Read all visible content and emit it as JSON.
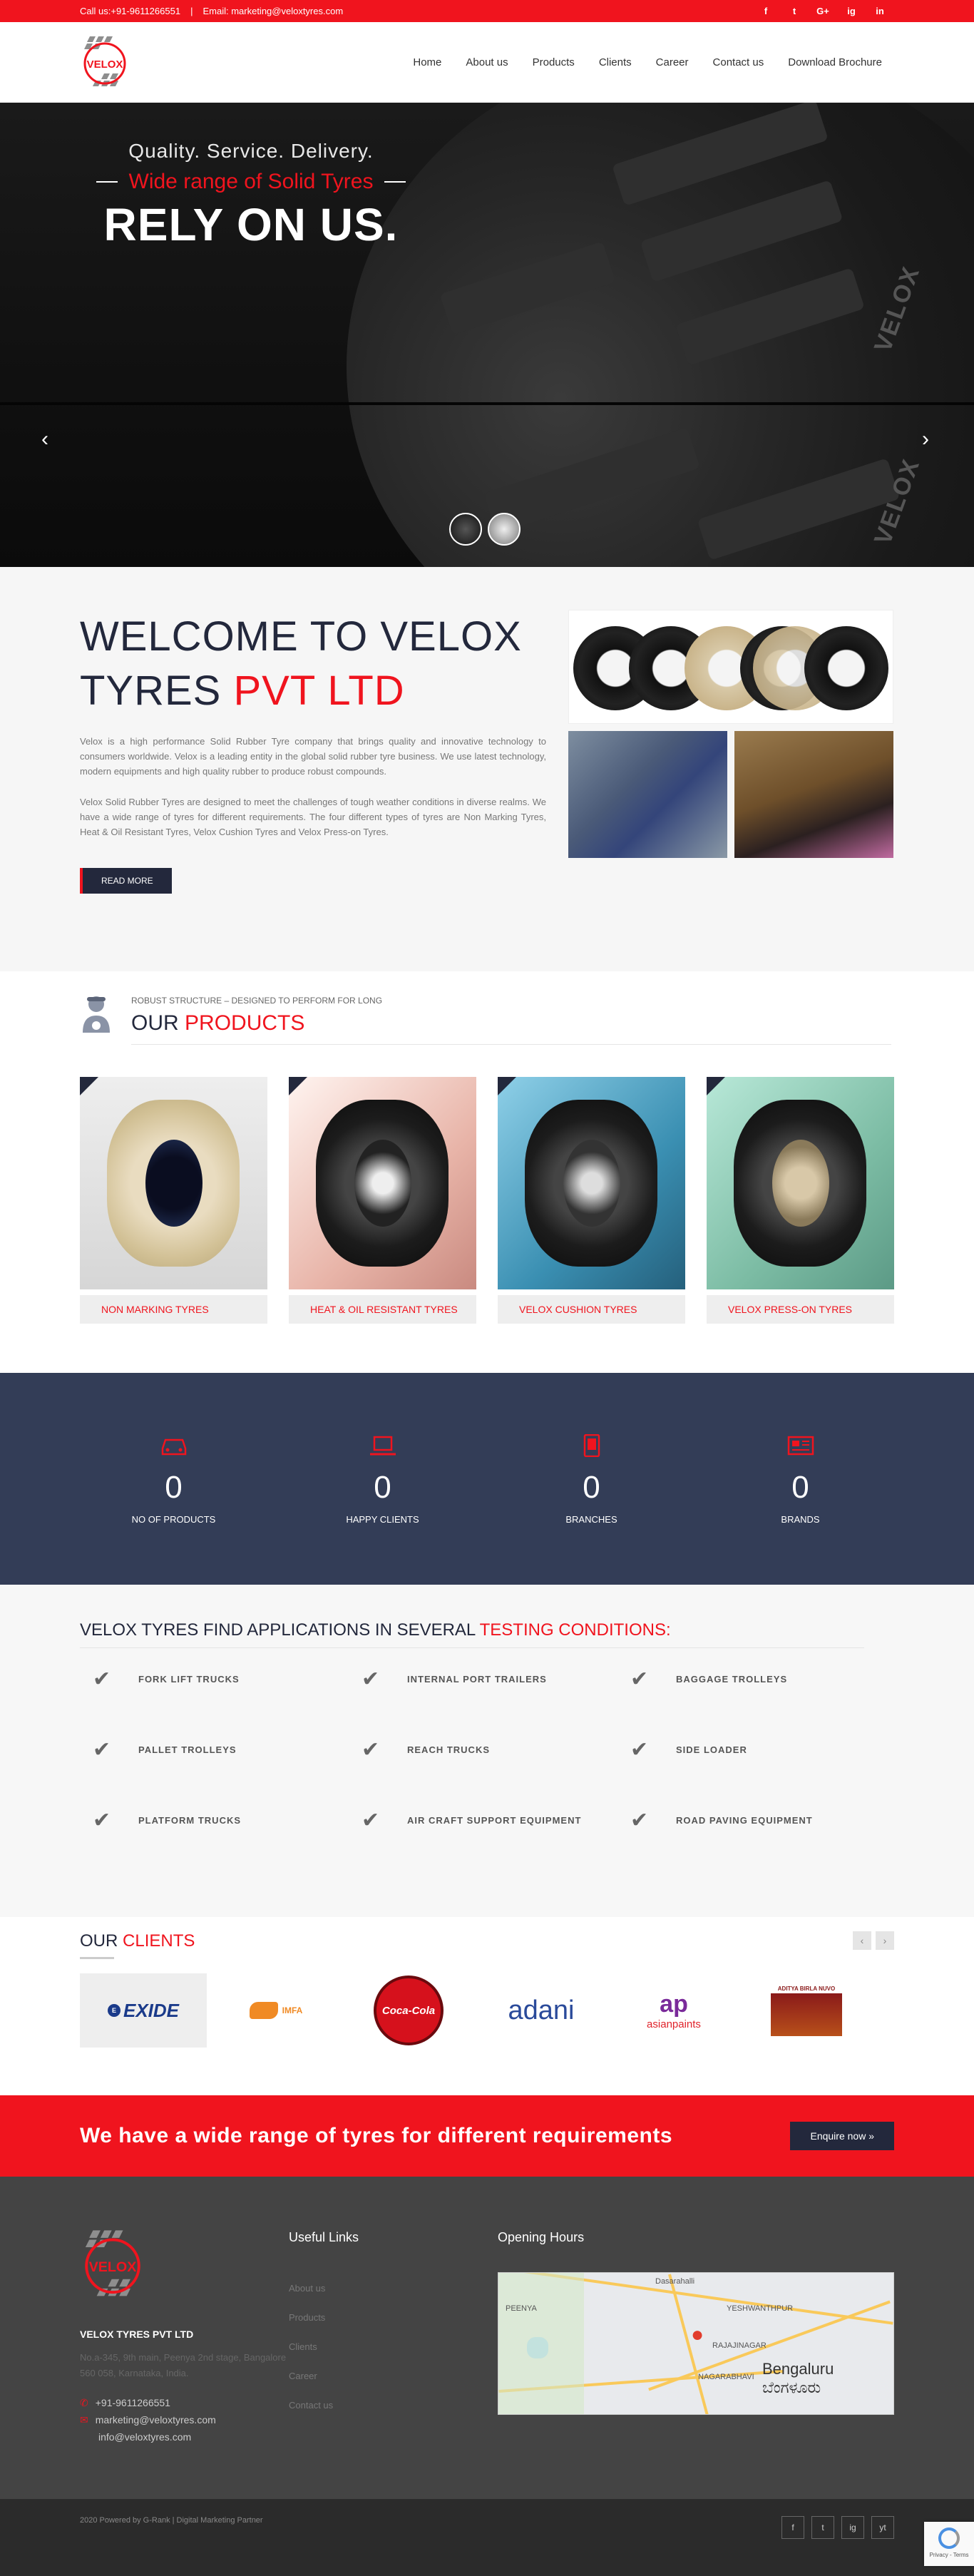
{
  "topbar": {
    "call": "Call us:+91-9611266551",
    "email": "Email: marketing@veloxtyres.com",
    "social": [
      "f",
      "t",
      "G+",
      "ig",
      "in"
    ]
  },
  "header": {
    "logo_text": "VELOX",
    "nav": [
      "Home",
      "About us",
      "Products",
      "Clients",
      "Career",
      "Contact us",
      "Download Brochure"
    ]
  },
  "hero": {
    "line1": "Quality. Service. Delivery.",
    "line2": "Wide range of Solid Tyres",
    "line3": "RELY ON US.",
    "brand": "VELOX"
  },
  "welcome": {
    "title_a": "WELCOME TO VELOX",
    "title_b": "TYRES",
    "title_c": "PVT LTD",
    "para1": "Velox is a high performance Solid Rubber Tyre company that brings quality and innovative technology to consumers worldwide. Velox is a leading entity in the global solid rubber tyre business. We use latest technology, modern equipments and high quality rubber to produce robust compounds.",
    "para2": "Velox Solid Rubber Tyres are designed to meet the challenges of tough weather conditions in diverse realms. We have a wide range of tyres for different requirements. The four different types of tyres are Non Marking Tyres, Heat & Oil Resistant Tyres, Velox Cushion Tyres and Velox Press-on Tyres.",
    "button": "READ MORE"
  },
  "products": {
    "tagline": "ROBUST STRUCTURE – DESIGNED TO PERFORM FOR LONG",
    "title_a": "OUR",
    "title_b": "PRODUCTS",
    "items": [
      {
        "label": "NON MARKING TYRES"
      },
      {
        "label": "HEAT & OIL RESISTANT TYRES"
      },
      {
        "label": "VELOX CUSHION TYRES"
      },
      {
        "label": "VELOX PRESS-ON TYRES"
      }
    ]
  },
  "counters": [
    {
      "num": "0",
      "label": "NO OF PRODUCTS"
    },
    {
      "num": "0",
      "label": "HAPPY CLIENTS"
    },
    {
      "num": "0",
      "label": "BRANCHES"
    },
    {
      "num": "0",
      "label": "BRANDS"
    }
  ],
  "applications": {
    "title_a": "VELOX TYRES FIND APPLICATIONS IN SEVERAL",
    "title_b": "TESTING CONDITIONS:",
    "items": [
      "FORK LIFT TRUCKS",
      "INTERNAL PORT TRAILERS",
      "BAGGAGE TROLLEYS",
      "PALLET TROLLEYS",
      "REACH TRUCKS",
      "SIDE LOADER",
      "PLATFORM TRUCKS",
      "AIR CRAFT SUPPORT EQUIPMENT",
      "ROAD PAVING EQUIPMENT"
    ]
  },
  "clients": {
    "title_a": "OUR",
    "title_b": "CLIENTS",
    "logos": [
      "EXIDE",
      "IMFA",
      "Coca-Cola",
      "adani",
      "asianpaints",
      "ADITYA BIRLA NUVO"
    ]
  },
  "cta": {
    "text": "We have a wide range of tyres for different requirements",
    "button": "Enquire now"
  },
  "footer": {
    "company": "VELOX TYRES PVT LTD",
    "address": "No.a-345, 9th main, Peenya 2nd stage, Bangalore 560 058, Karnataka, India.",
    "phone": "+91-9611266551",
    "email1": "marketing@veloxtyres.com",
    "email2": "info@veloxtyres.com",
    "useful_title": "Useful Links",
    "links": [
      "About us",
      "Products",
      "Clients",
      "Career",
      "Contact us"
    ],
    "hours_title": "Opening Hours",
    "map_city": "Bengaluru",
    "map_city_local": "ಬೆಂಗಳೂರು",
    "map_labels": [
      "Dasarahalli",
      "PEENYA",
      "NAGARABHAVI",
      "RAJAJINAGAR",
      "YESHWANTHPUR"
    ]
  },
  "bottom": {
    "copyright": "2020 Powered by G-Rank | Digital Marketing Partner",
    "social": [
      "f",
      "t",
      "ig",
      "yt"
    ],
    "recaptcha": "Privacy - Terms"
  }
}
